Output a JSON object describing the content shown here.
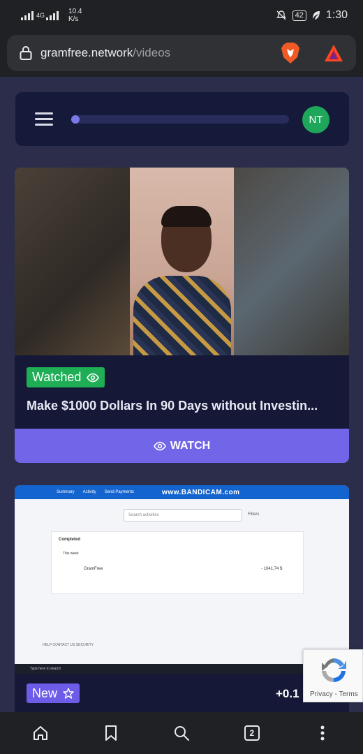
{
  "status_bar": {
    "network_1": "4G",
    "speed_value": "10.4",
    "speed_unit": "K/s",
    "battery": "42",
    "time": "1:30"
  },
  "browser": {
    "url_host": "gramfree.network",
    "url_path": "/videos",
    "icons": [
      "lock-icon",
      "brave-lion-icon",
      "bat-rewards-icon"
    ]
  },
  "topnav": {
    "avatar_initials": "NT",
    "progress_fraction": 0.04,
    "progress_color": "#7b78e8",
    "avatar_color": "#1ea65a"
  },
  "videos": [
    {
      "status": "Watched",
      "title": "Make $1000 Dollars In 90 Days without Investin...",
      "button_label": "WATCH"
    },
    {
      "status": "New",
      "reward": "+0.1",
      "screenshot": {
        "menu": [
          "Summary",
          "Activity",
          "Send Payments"
        ],
        "watermark": "www.BANDICAM.com",
        "search_placeholder": "Search activities",
        "filters": "Filters",
        "section": "Completed",
        "period": "This week",
        "merchant": "GramFree",
        "amount": "- 1041,74 $",
        "footer_links": "HELP   CONTACT US   SECURITY",
        "taskbar_search": "Type here to search"
      }
    }
  ],
  "recaptcha": {
    "links": "Privacy - Terms"
  },
  "bottom_bar": {
    "tab_count": "2",
    "icons": [
      "home-icon",
      "bookmark-icon",
      "search-icon",
      "tabs-icon",
      "more-icon"
    ]
  },
  "colors": {
    "page_bg": "#2b2d4b",
    "card_bg": "#151837",
    "accent": "#7166e8",
    "watched_green": "#1fae56"
  }
}
